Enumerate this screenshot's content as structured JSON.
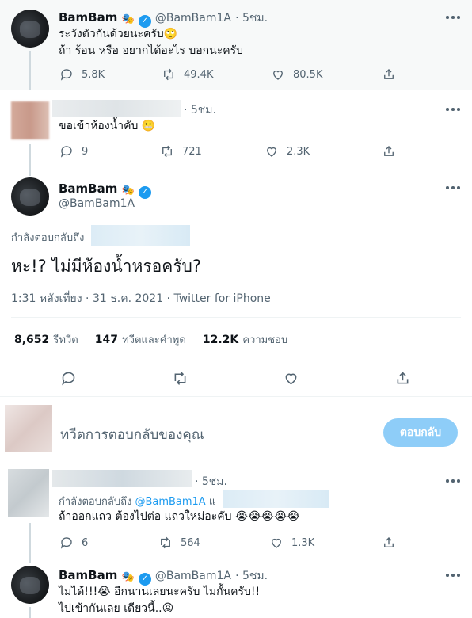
{
  "tweet1": {
    "name": "BamBam",
    "badge_emoji": "🎭",
    "handle": "@BamBam1A",
    "time": "· 5ชม.",
    "line1": "ระวังตัวกันด้วยนะครับ",
    "line1_emoji": "🙄",
    "line2": "ถ้า ร้อน หรือ อยากได้อะไร บอกนะครับ",
    "replies": "5.8K",
    "retweets": "49.4K",
    "likes": "80.5K"
  },
  "tweet2": {
    "time": "· 5ชม.",
    "text": "ขอเข้าห้องน้ำคับ",
    "emoji": "😬",
    "replies": "9",
    "retweets": "721",
    "likes": "2.3K"
  },
  "main_tweet": {
    "name": "BamBam",
    "badge_emoji": "🎭",
    "handle": "@BamBam1A",
    "replying_to": "กำลังตอบกลับถึง",
    "text": "หะ!? ไม่มีห้องน้ำหรอครับ?",
    "time": "1:31 หลังเที่ยง",
    "date": "31 ธ.ค. 2021",
    "source": "Twitter for iPhone",
    "retweets_num": "8,652",
    "retweets_label": "รีทวีต",
    "quotes_num": "147",
    "quotes_label": "ทวีตและคำพูด",
    "likes_num": "12.2K",
    "likes_label": "ความชอบ"
  },
  "composer": {
    "placeholder": "ทวีตการตอบกลับของคุณ",
    "button": "ตอบกลับ"
  },
  "reply1": {
    "time": "· 5ชม.",
    "replying_to": "กำลังตอบกลับถึง",
    "mention": "@BamBam1A",
    "mention_and": "แ",
    "text": "ถ้าออกแถว ต้องไปต่อ แถวใหม่อะคับ",
    "emoji": "😭😭😭😭😭",
    "replies": "6",
    "retweets": "564",
    "likes": "1.3K"
  },
  "reply2": {
    "name": "BamBam",
    "badge_emoji": "🎭",
    "handle": "@BamBam1A",
    "time": "· 5ชม.",
    "line1a": "ไม่ได้!!!",
    "line1_emoji": "😭",
    "line1b": " อีกนานเลยนะครับ ไม่กั้นครับ!!",
    "line2": "ไปเข้ากันเลย เดียวนี้..",
    "line2_emoji": "😡"
  },
  "colors": {
    "accent": "#1d9bf0",
    "muted": "#536471",
    "reply_button": "#8ecdf8"
  }
}
